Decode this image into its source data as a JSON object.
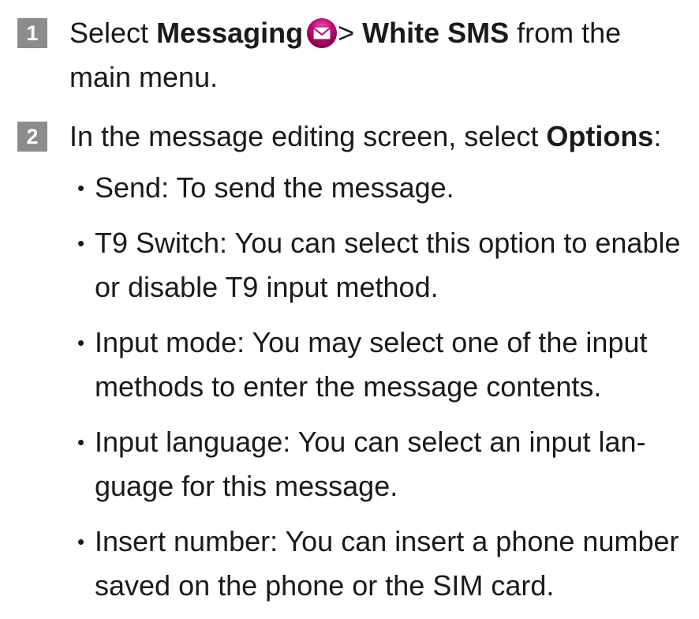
{
  "step1": {
    "number": "1",
    "select_prefix": "Select ",
    "messaging_label": "Messaging",
    "arrow": "> ",
    "white_sms_label": "White SMS",
    "suffix": " from the main menu.",
    "icon": "messaging-envelope-icon"
  },
  "step2": {
    "number": "2",
    "intro_prefix": "In the message editing screen, select ",
    "options_label": "Options",
    "intro_suffix": ":",
    "bullets": [
      "Send: To send the message.",
      "T9 Switch: You can select this option to enable or disable T9 input method.",
      "Input mode: You may select one of the input methods to enter the message contents.",
      "Input language: You can select an input lan-guage for this message.",
      "Insert number: You can insert a phone number saved on the phone or the SIM card."
    ]
  },
  "colors": {
    "badge": "#8c8c8c",
    "icon_magenta": "#c0006e"
  }
}
